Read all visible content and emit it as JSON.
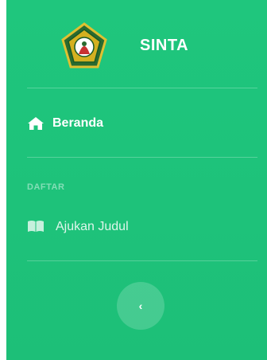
{
  "brand": {
    "title": "SINTA",
    "logo_icon": "university-emblem-icon"
  },
  "nav": {
    "beranda": {
      "label": "Beranda",
      "icon": "home-icon"
    },
    "section_heading": "DAFTAR",
    "ajukan_judul": {
      "label": "Ajukan Judul",
      "icon": "open-book-icon"
    }
  },
  "sidebar_toggle": {
    "label": "‹",
    "icon": "chevron-left-icon"
  },
  "colors": {
    "sidebar_bg": "#1fc67d",
    "text": "#ffffff",
    "logo_green": "#1a7a3a",
    "logo_gold": "#d4b020"
  }
}
